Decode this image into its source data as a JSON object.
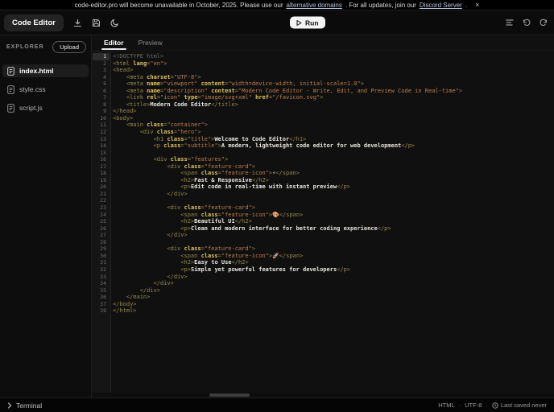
{
  "banner": {
    "message_start": "code-editor.pro will become unavailable in October, 2025. Please use our",
    "link_domains": "alternative domains",
    "message_mid": ". For all updates, join our",
    "link_discord": "Discord Server",
    "message_end": ".",
    "close": "×"
  },
  "header": {
    "brand": "Code Editor",
    "run_label": "Run"
  },
  "sidebar": {
    "title": "EXPLORER",
    "upload_label": "Upload",
    "files": [
      {
        "name": "index.html",
        "active": true
      },
      {
        "name": "style.css",
        "active": false
      },
      {
        "name": "script.js",
        "active": false
      }
    ]
  },
  "editor": {
    "tabs": [
      {
        "label": "Editor",
        "active": true
      },
      {
        "label": "Preview",
        "active": false
      }
    ],
    "code": [
      [
        [
          "c",
          "<!DOCTYPE html>"
        ]
      ],
      [
        [
          "t",
          "<html "
        ],
        [
          "a",
          "lang"
        ],
        [
          "t",
          "="
        ],
        [
          "s",
          "\"en\""
        ],
        [
          "t",
          ">"
        ]
      ],
      [
        [
          "t",
          "<head>"
        ]
      ],
      [
        [
          "t",
          "    <meta "
        ],
        [
          "a",
          "charset"
        ],
        [
          "t",
          "="
        ],
        [
          "s",
          "\"UTF-8\""
        ],
        [
          "t",
          ">"
        ]
      ],
      [
        [
          "t",
          "    <meta "
        ],
        [
          "a",
          "name"
        ],
        [
          "t",
          "="
        ],
        [
          "s",
          "\"viewport\" "
        ],
        [
          "a",
          "content"
        ],
        [
          "t",
          "="
        ],
        [
          "s",
          "\"width=device-width, initial-scale=1.0\""
        ],
        [
          "t",
          ">"
        ]
      ],
      [
        [
          "t",
          "    <meta "
        ],
        [
          "a",
          "name"
        ],
        [
          "t",
          "="
        ],
        [
          "s",
          "\"description\" "
        ],
        [
          "a",
          "content"
        ],
        [
          "t",
          "="
        ],
        [
          "s",
          "\"Modern Code Editor - Write, Edit, and Preview Code in Real-time\""
        ],
        [
          "t",
          ">"
        ]
      ],
      [
        [
          "t",
          "    <link "
        ],
        [
          "a",
          "rel"
        ],
        [
          "t",
          "="
        ],
        [
          "s",
          "\"icon\" "
        ],
        [
          "a",
          "type"
        ],
        [
          "t",
          "="
        ],
        [
          "s",
          "\"image/svg+xml\" "
        ],
        [
          "a",
          "href"
        ],
        [
          "t",
          "="
        ],
        [
          "s",
          "\"/favicon.svg\""
        ],
        [
          "t",
          ">"
        ]
      ],
      [
        [
          "t",
          "    <title>"
        ],
        [
          "x",
          "Modern Code Editor"
        ],
        [
          "t",
          "</title>"
        ]
      ],
      [
        [
          "t",
          "</head>"
        ]
      ],
      [
        [
          "t",
          "<body>"
        ]
      ],
      [
        [
          "t",
          "    <main "
        ],
        [
          "a",
          "class"
        ],
        [
          "t",
          "="
        ],
        [
          "s",
          "\"container\""
        ],
        [
          "t",
          ">"
        ]
      ],
      [
        [
          "t",
          "        <div "
        ],
        [
          "a",
          "class"
        ],
        [
          "t",
          "="
        ],
        [
          "s",
          "\"hero\""
        ],
        [
          "t",
          ">"
        ]
      ],
      [
        [
          "t",
          "            <h1 "
        ],
        [
          "a",
          "class"
        ],
        [
          "t",
          "="
        ],
        [
          "s",
          "\"title\""
        ],
        [
          "t",
          ">"
        ],
        [
          "x",
          "Welcome to Code Editor"
        ],
        [
          "t",
          "</h1>"
        ]
      ],
      [
        [
          "t",
          "            <p "
        ],
        [
          "a",
          "class"
        ],
        [
          "t",
          "="
        ],
        [
          "s",
          "\"subtitle\""
        ],
        [
          "t",
          ">"
        ],
        [
          "x",
          "A modern, lightweight code editor for web development"
        ],
        [
          "t",
          "</p>"
        ]
      ],
      [],
      [
        [
          "t",
          "            <div "
        ],
        [
          "a",
          "class"
        ],
        [
          "t",
          "="
        ],
        [
          "s",
          "\"features\""
        ],
        [
          "t",
          ">"
        ]
      ],
      [
        [
          "t",
          "                <div "
        ],
        [
          "a",
          "class"
        ],
        [
          "t",
          "="
        ],
        [
          "s",
          "\"feature-card\""
        ],
        [
          "t",
          ">"
        ]
      ],
      [
        [
          "t",
          "                    <span "
        ],
        [
          "a",
          "class"
        ],
        [
          "t",
          "="
        ],
        [
          "s",
          "\"feature-icon\""
        ],
        [
          "t",
          ">"
        ],
        [
          "x",
          "⚡"
        ],
        [
          "t",
          "</span>"
        ]
      ],
      [
        [
          "t",
          "                    <h2>"
        ],
        [
          "x",
          "Fast & Responsive"
        ],
        [
          "t",
          "</h2>"
        ]
      ],
      [
        [
          "t",
          "                    <p>"
        ],
        [
          "x",
          "Edit code in real-time with instant preview"
        ],
        [
          "t",
          "</p>"
        ]
      ],
      [
        [
          "t",
          "                </div>"
        ]
      ],
      [],
      [
        [
          "t",
          "                <div "
        ],
        [
          "a",
          "class"
        ],
        [
          "t",
          "="
        ],
        [
          "s",
          "\"feature-card\""
        ],
        [
          "t",
          ">"
        ]
      ],
      [
        [
          "t",
          "                    <span "
        ],
        [
          "a",
          "class"
        ],
        [
          "t",
          "="
        ],
        [
          "s",
          "\"feature-icon\""
        ],
        [
          "t",
          ">"
        ],
        [
          "x",
          "🎨"
        ],
        [
          "t",
          "</span>"
        ]
      ],
      [
        [
          "t",
          "                    <h2>"
        ],
        [
          "x",
          "Beautiful UI"
        ],
        [
          "t",
          "</h2>"
        ]
      ],
      [
        [
          "t",
          "                    <p>"
        ],
        [
          "x",
          "Clean and modern interface for better coding experience"
        ],
        [
          "t",
          "</p>"
        ]
      ],
      [
        [
          "t",
          "                </div>"
        ]
      ],
      [],
      [
        [
          "t",
          "                <div "
        ],
        [
          "a",
          "class"
        ],
        [
          "t",
          "="
        ],
        [
          "s",
          "\"feature-card\""
        ],
        [
          "t",
          ">"
        ]
      ],
      [
        [
          "t",
          "                    <span "
        ],
        [
          "a",
          "class"
        ],
        [
          "t",
          "="
        ],
        [
          "s",
          "\"feature-icon\""
        ],
        [
          "t",
          ">"
        ],
        [
          "x",
          "🚀"
        ],
        [
          "t",
          "</span>"
        ]
      ],
      [
        [
          "t",
          "                    <h2>"
        ],
        [
          "x",
          "Easy to Use"
        ],
        [
          "t",
          "</h2>"
        ]
      ],
      [
        [
          "t",
          "                    <p>"
        ],
        [
          "x",
          "Simple yet powerful features for developers"
        ],
        [
          "t",
          "</p>"
        ]
      ],
      [
        [
          "t",
          "                </div>"
        ]
      ],
      [
        [
          "t",
          "            </div>"
        ]
      ],
      [
        [
          "t",
          "        </div>"
        ]
      ],
      [
        [
          "t",
          "    </main>"
        ]
      ],
      [
        [
          "t",
          "</body>"
        ]
      ],
      [
        [
          "t",
          "</html>"
        ]
      ]
    ]
  },
  "terminal": {
    "label": "Terminal"
  },
  "statusbar": {
    "language": "HTML",
    "encoding": "UTF-8",
    "saved": "Last saved never",
    "separator": "·"
  },
  "colors": {
    "syntax_tag": "#968849",
    "syntax_attr": "#dec05e",
    "syntax_string": "#bd7e4d",
    "syntax_text": "#e8e5df",
    "syntax_comment": "#6b6b60",
    "accent": "#ffffff"
  }
}
